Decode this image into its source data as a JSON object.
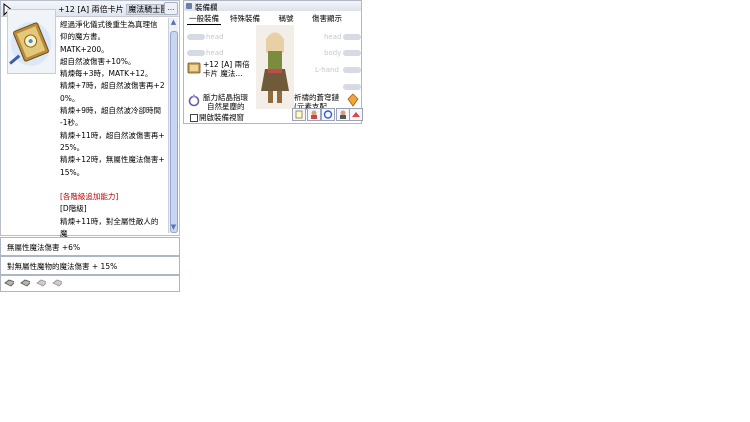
{
  "item_window": {
    "title_prefix": "+12 [A] 兩倍卡片",
    "title_highlight": "魔法騎士團",
    "more_button": "...",
    "description": [
      "經過淨化儀式後重生為真理信",
      "仰的魔方書。",
      "MATK+200。",
      "超自然波傷害+10%。",
      "精煉每+3時，MATK+12。",
      "精煉+7時，超自然波傷害再+2",
      "0%。",
      "精煉+9時，超自然波冷卻時間",
      "-1秒。",
      "精煉+11時，超自然波傷害再+",
      "25%。",
      "精煉+12時，無屬性魔法傷害+",
      "15%。",
      "",
      "[各階級追加能力]",
      "[D階級]",
      "精煉+11時，對全屬性敵人的魔"
    ],
    "scroll_up": "▲",
    "scroll_down": "▼"
  },
  "options": [
    "無屬性魔法傷害 +6%",
    "對無屬性魔物的魔法傷害 + 15%"
  ],
  "card_slots": [
    "empty-slot",
    "empty-slot",
    "empty-slot",
    "empty-slot"
  ],
  "equip_window": {
    "title": "裝備欄",
    "tabs": [
      "一般裝備",
      "特殊裝備",
      "稱號",
      "傷害顯示"
    ],
    "slot_labels": {
      "left_1": "head",
      "left_2": "head",
      "right_1": "head",
      "right_2": "body",
      "right_3": "L-hand"
    },
    "left_item_name": [
      "+12 [A] 兩倍",
      "卡片 魔法..."
    ],
    "right_item_name": [
      "祈禱的蒼穹鏈",
      "(元素支配..."
    ],
    "left_bottom_item": [
      "脈力結晶指環",
      "自然星塵的"
    ],
    "show_window_label": "開啟裝備視窗",
    "colors": {
      "frame": "#b0b8c6",
      "tab_active": "#000000"
    }
  }
}
